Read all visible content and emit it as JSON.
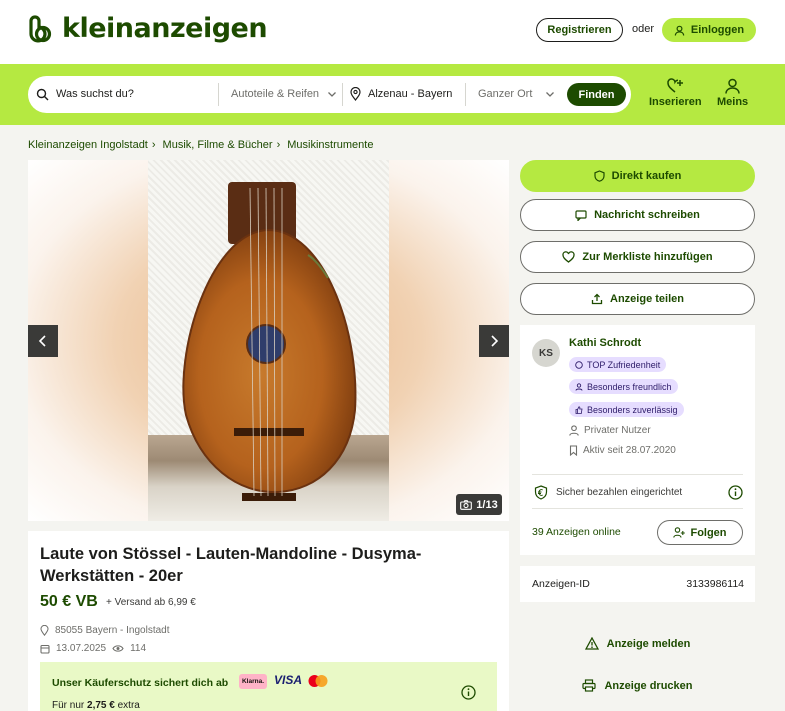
{
  "header": {
    "logo_text": "kleinanzeigen",
    "register_label": "Registrieren",
    "or_label": "oder",
    "login_label": "Einloggen"
  },
  "search": {
    "query": "Was suchst du?",
    "category": "Autoteile & Reifen",
    "location": "Alzenau - Bayern",
    "radius": "Ganzer Ort",
    "find_label": "Finden"
  },
  "nav": {
    "post_label": "Inserieren",
    "mine_label": "Meins"
  },
  "breadcrumb": [
    "Kleinanzeigen Ingolstadt",
    "Musik, Filme & Bücher",
    "Musikinstrumente"
  ],
  "gallery": {
    "counter": "1/13"
  },
  "ad": {
    "title": "Laute von Stössel - Lauten-Mandoline - Dusyma-Werkstätten - 20er",
    "price": "50 € VB",
    "shipping": "+ Versand ab 6,99 €",
    "location": "85055 Bayern - Ingolstadt",
    "date": "13.07.2025",
    "views": "114"
  },
  "protection": {
    "text": "Unser Käuferschutz sichert dich ab",
    "klarna": "Klarna.",
    "visa": "VISA",
    "sub_prefix": "Für nur",
    "sub_price": "2,75 €",
    "sub_suffix": "extra"
  },
  "actions": {
    "buy": "Direkt kaufen",
    "message": "Nachricht schreiben",
    "watchlist": "Zur Merkliste hinzufügen",
    "share": "Anzeige teilen"
  },
  "seller": {
    "initials": "KS",
    "name": "Kathi Schrodt",
    "badges": [
      "TOP Zufriedenheit",
      "Besonders freundlich",
      "Besonders zuverlässig"
    ],
    "type": "Privater Nutzer",
    "active_since": "Aktiv seit 28.07.2020",
    "secure_payment": "Sicher bezahlen eingerichtet",
    "ads_online": "39 Anzeigen online",
    "follow_label": "Folgen"
  },
  "ad_id": {
    "label": "Anzeigen-ID",
    "value": "3133986114"
  },
  "footer_actions": {
    "report": "Anzeige melden",
    "print": "Anzeige drucken"
  },
  "colors": {
    "brand_dark": "#1d4b00",
    "brand_lime": "#b5e941",
    "badge_purple": "#e6ddff"
  }
}
